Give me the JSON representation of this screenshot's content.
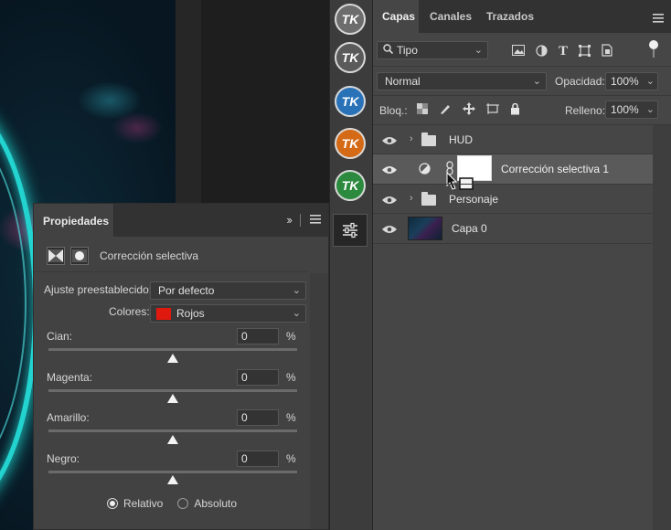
{
  "properties": {
    "tab_label": "Propiedades",
    "expand_icon": "double-chevron-right-icon",
    "menu_icon": "hamburger-menu-icon",
    "adjustment_type": "Corrección selectiva",
    "preset_label": "Ajuste preestablecido:",
    "preset_value": "Por defecto",
    "colors_label": "Colores:",
    "colors_value": "Rojos",
    "colors_swatch": "#e0190f",
    "sliders": [
      {
        "label": "Cian:",
        "value": "0",
        "unit": "%"
      },
      {
        "label": "Magenta:",
        "value": "0",
        "unit": "%"
      },
      {
        "label": "Amarillo:",
        "value": "0",
        "unit": "%"
      },
      {
        "label": "Negro:",
        "value": "0",
        "unit": "%"
      }
    ],
    "method_options": [
      {
        "label": "Relativo",
        "selected": true
      },
      {
        "label": "Absoluto",
        "selected": false
      }
    ]
  },
  "strip": {
    "plugin_icons": [
      {
        "text": "TK",
        "color": "#6d6d6d"
      },
      {
        "text": "TK",
        "color": "#5a5a5a"
      },
      {
        "text": "TK",
        "color": "#2a72b8"
      },
      {
        "text": "TK",
        "color": "#d46a16"
      },
      {
        "text": "TK",
        "color": "#2c8a3e"
      }
    ],
    "adjust_icon": "sliders-icon"
  },
  "layers": {
    "tabs": [
      "Capas",
      "Canales",
      "Trazados"
    ],
    "active_tab": "Capas",
    "filter_label": "Tipo",
    "blend_mode": "Normal",
    "opacity_label": "Opacidad:",
    "opacity_value": "100%",
    "lock_label": "Bloq.:",
    "fill_label": "Relleno:",
    "fill_value": "100%",
    "items": [
      {
        "name": "HUD",
        "kind": "group"
      },
      {
        "name": "Corrección selectiva 1",
        "kind": "adjustment"
      },
      {
        "name": "Personaje",
        "kind": "group"
      },
      {
        "name": "Capa 0",
        "kind": "pixel"
      }
    ]
  }
}
